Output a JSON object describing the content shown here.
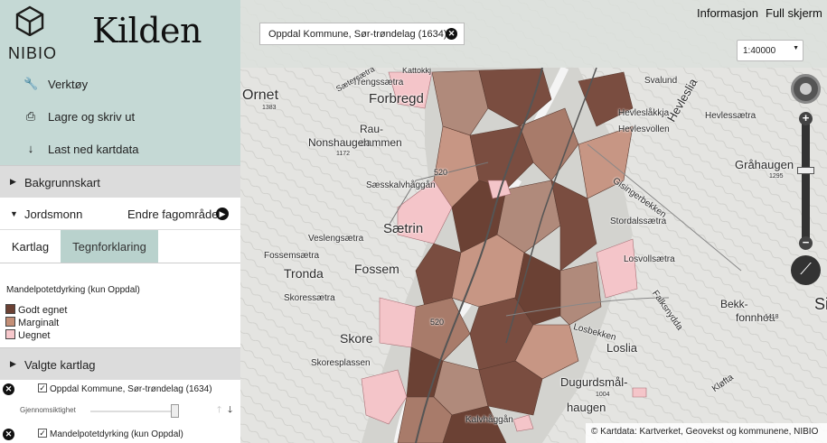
{
  "header": {
    "logo_text": "NIBIO",
    "app_title": "Kilden",
    "search_value": "Oppdal Kommune, Sør-trøndelag (1634)",
    "links": [
      "Informasjon",
      "Full skjerm"
    ],
    "scale_value": "1:40000"
  },
  "sidebar": {
    "tools": [
      {
        "label": "Verktøy",
        "icon": "wrench-icon"
      },
      {
        "label": "Lagre og skriv ut",
        "icon": "printer-icon"
      },
      {
        "label": "Last ned kartdata",
        "icon": "download-icon"
      }
    ],
    "bakgrunnskart": "Bakgrunnskart",
    "jordsmonn": "Jordsmonn",
    "change_area": "Endre fagområde",
    "tabs": [
      "Kartlag",
      "Tegnforklaring"
    ],
    "legend_title": "Mandelpotetdyrking (kun Oppdal)",
    "legend_items": [
      {
        "label": "Godt egnet",
        "color": "#6b4134"
      },
      {
        "label": "Marginalt",
        "color": "#c48f77"
      },
      {
        "label": "Uegnet",
        "color": "#f7c8cc"
      }
    ],
    "selected_layers_title": "Valgte kartlag",
    "layers": [
      {
        "name": "Oppdal Kommune, Sør-trøndelag (1634)",
        "opacity_label": "Gjennomsiktighet",
        "checked": true,
        "opacity": 0.95
      },
      {
        "name": "Mandelpotetdyrking (kun Oppdal)",
        "checked": true
      }
    ]
  },
  "map": {
    "place_labels": [
      "Ornet",
      "1383",
      "Forbregd",
      "Rau-",
      "dammen",
      "Nonshaugen",
      "1172",
      "Sæsskalvhåggån",
      "Sætrin",
      "Veslengsætra",
      "Fossemsætra",
      "Tronda",
      "Fossem",
      "Skoressætra",
      "Skore",
      "Skoresplassen",
      "Hevleslåkkja",
      "Hevlessætra",
      "Hevlesvollen",
      "Hevleslia",
      "Gisingerbekken",
      "Stordalssætra",
      "Gråhaugen",
      "1295",
      "Losvollsætra",
      "Falksnydda",
      "Bekk-",
      "fonnhoa",
      "1418",
      "Losbekken",
      "Loslia",
      "Dugurdsmål-",
      "haugen",
      "1004",
      "Kløfta",
      "Kalvhåggån",
      "520",
      "520",
      "Svalund",
      "Trengssætra",
      "Kattokkj",
      "Sætersætra",
      "Si"
    ],
    "attribution": "© Kartdata: Kartverket, Geovekst og kommunene, NIBIO"
  },
  "colors": {
    "sidebar_accent": "#c5d9d5",
    "good": "#6b4134",
    "marginal": "#c48f77",
    "unsuitable": "#f7c8cc"
  }
}
